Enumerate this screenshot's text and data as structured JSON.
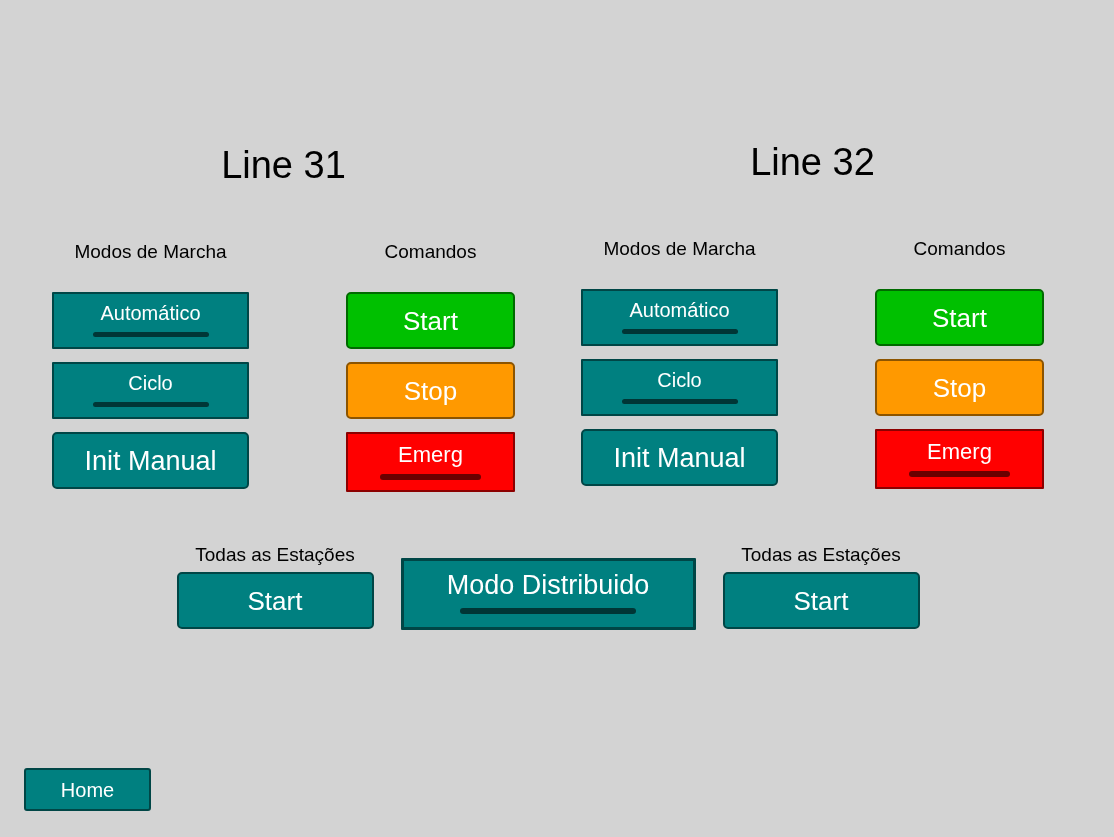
{
  "lines": [
    {
      "title": "Line 31",
      "modes": {
        "heading": "Modos de Marcha",
        "buttons": [
          {
            "label": "Automático",
            "kind": "toggle",
            "on": false
          },
          {
            "label": "Ciclo",
            "kind": "toggle",
            "on": false
          },
          {
            "label": "Init Manual",
            "kind": "push"
          }
        ]
      },
      "commands": {
        "heading": "Comandos",
        "buttons": [
          {
            "label": "Start",
            "kind": "push",
            "color": "#00c000"
          },
          {
            "label": "Stop",
            "kind": "push",
            "color": "#ff9900"
          },
          {
            "label": "Emerg",
            "kind": "toggle",
            "on": false,
            "color": "#ff0000"
          }
        ]
      }
    },
    {
      "title": "Line 32",
      "modes": {
        "heading": "Modos de Marcha",
        "buttons": [
          {
            "label": "Automático",
            "kind": "toggle",
            "on": false
          },
          {
            "label": "Ciclo",
            "kind": "toggle",
            "on": false
          },
          {
            "label": "Init Manual",
            "kind": "push"
          }
        ]
      },
      "commands": {
        "heading": "Comandos",
        "buttons": [
          {
            "label": "Start",
            "kind": "push",
            "color": "#00c000"
          },
          {
            "label": "Stop",
            "kind": "push",
            "color": "#ff9900"
          },
          {
            "label": "Emerg",
            "kind": "toggle",
            "on": false,
            "color": "#ff0000"
          }
        ]
      }
    }
  ],
  "global_controls": [
    {
      "kind": "station_start",
      "heading": "Todas as Estações",
      "label": "Start"
    },
    {
      "kind": "toggle",
      "label": "Modo Distribuido",
      "on": false
    },
    {
      "kind": "station_start",
      "heading": "Todas as Estações",
      "label": "Start"
    }
  ],
  "home_button": {
    "label": "Home"
  }
}
